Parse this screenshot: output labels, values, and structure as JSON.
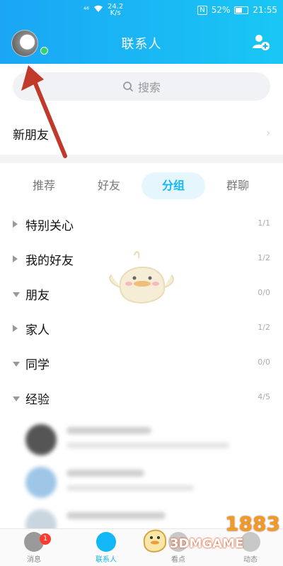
{
  "status_bar": {
    "signal": "⁴⁶",
    "speed_value": "24.2",
    "speed_unit": "K/s",
    "nfc": "N",
    "battery_percent": "52%",
    "time": "21:55"
  },
  "header": {
    "title": "联系人"
  },
  "search": {
    "placeholder": "搜索"
  },
  "new_friends": {
    "label": "新朋友"
  },
  "tabs": [
    {
      "label": "推荐",
      "active": false
    },
    {
      "label": "好友",
      "active": false
    },
    {
      "label": "分组",
      "active": true
    },
    {
      "label": "群聊",
      "active": false
    }
  ],
  "groups": [
    {
      "name": "特别关心",
      "count": "1/1",
      "expanded": false
    },
    {
      "name": "我的好友",
      "count": "1/2",
      "expanded": false
    },
    {
      "name": "朋友",
      "count": "0/0",
      "expanded": true
    },
    {
      "name": "家人",
      "count": "1/2",
      "expanded": false
    },
    {
      "name": "同学",
      "count": "0/0",
      "expanded": true
    },
    {
      "name": "经验",
      "count": "4/5",
      "expanded": true
    }
  ],
  "bottom_nav": [
    {
      "label": "消息",
      "badge": "1",
      "active": false
    },
    {
      "label": "联系人",
      "active": true
    },
    {
      "label": "看点",
      "active": false
    },
    {
      "label": "动态",
      "active": false
    }
  ],
  "watermark": {
    "logo": "1883",
    "text": "3DMGAME"
  },
  "colors": {
    "header_gradient_start": "#1aa6f5",
    "header_gradient_end": "#19c7f4",
    "accent": "#12b7f5",
    "badge": "#ff3b30",
    "annotation_arrow": "#c0392b"
  }
}
